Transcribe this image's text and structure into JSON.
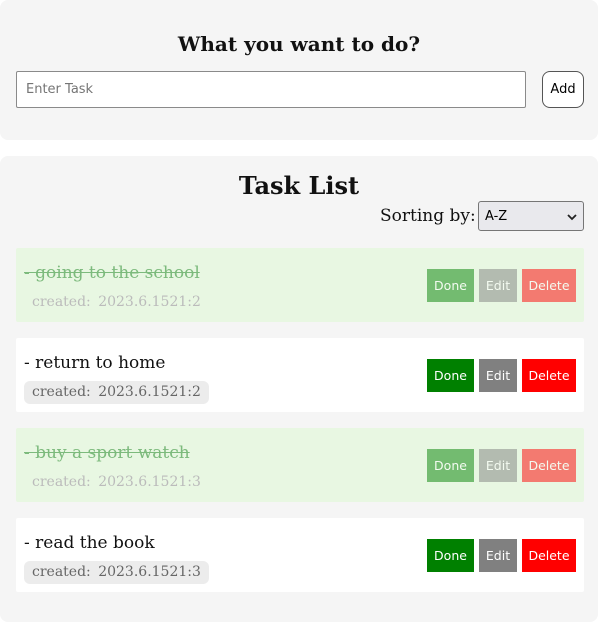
{
  "header": {
    "title": "What you want to do?",
    "input_placeholder": "Enter Task",
    "input_value": "",
    "add_label": "Add"
  },
  "list": {
    "title": "Task List",
    "sort_label": "Sorting by:",
    "sort_value": "A-Z",
    "done_label": "Done",
    "edit_label": "Edit",
    "delete_label": "Delete",
    "tasks": [
      {
        "text": "- going to the school",
        "created": "created: 2023.6.1521:2",
        "completed": true
      },
      {
        "text": "- return to home",
        "created": "created: 2023.6.1521:2",
        "completed": false
      },
      {
        "text": "- buy a sport watch",
        "created": "created: 2023.6.1521:3",
        "completed": true
      },
      {
        "text": "- read the book",
        "created": "created: 2023.6.1521:3",
        "completed": false
      }
    ]
  },
  "colors": {
    "card_background": "#f5f5f5",
    "completed_task_background": "#e8f7e2",
    "completed_text": "#7cba7c",
    "done_button": "#008000",
    "edit_button": "#808080",
    "delete_button": "#ff0000"
  },
  "icons": {
    "sort_dropdown": "chevron-down-icon"
  }
}
